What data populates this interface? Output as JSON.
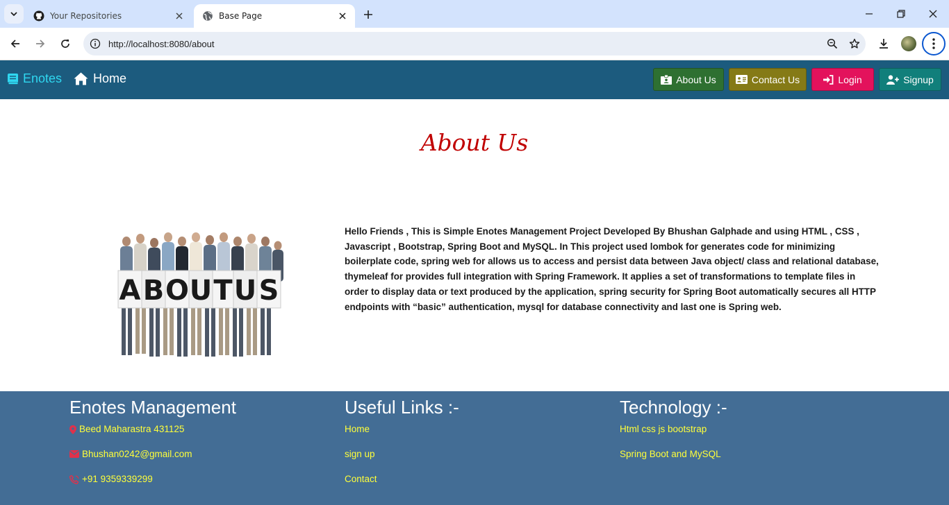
{
  "browser": {
    "tabs": [
      {
        "title": "Your Repositories",
        "active": false
      },
      {
        "title": "Base Page",
        "active": true
      }
    ],
    "url_host": "http://localhost",
    "url_rest": ":8080/about"
  },
  "navbar": {
    "brand": "Enotes",
    "home": "Home",
    "buttons": {
      "about": "About Us",
      "contact": "Contact Us",
      "login": "Login",
      "signup": "Signup"
    },
    "colors": {
      "bar": "#1c5b7e",
      "about": "#2e7031",
      "contact": "#857a16",
      "login": "#e3125c",
      "signup": "#117f7b"
    }
  },
  "main": {
    "title": "About Us",
    "image_text": "ABOUT US",
    "paragraph": "Hello Friends , This is Simple Enotes Management Project Developed By Bhushan Galphade and using HTML , CSS , Javascript , Bootstrap, Spring Boot and MySQL. In This project used lombok for generates code for minimizing boilerplate code, spring web for allows us to access and persist data between Java object/ class and relational database, thymeleaf for provides full integration with Spring Framework. It applies a set of transformations to template files in order to display data or text produced by the application, spring security for Spring Boot automatically secures all HTTP endpoints with “basic” authentication, mysql for database connectivity and last one is Spring web."
  },
  "footer": {
    "col1": {
      "title": "Enotes Management",
      "address": "Beed Maharastra 431125",
      "email": "Bhushan0242@gmail.com",
      "phone": "+91 9359339299"
    },
    "col2": {
      "title": "Useful Links :-",
      "links": [
        "Home",
        "sign up",
        "Contact"
      ]
    },
    "col3": {
      "title": "Technology :-",
      "items": [
        "Html css js bootstrap",
        "Spring Boot and MySQL"
      ]
    },
    "colors": {
      "bg": "#436d95",
      "link": "#ffff3a",
      "icon": "#e0314b"
    }
  }
}
